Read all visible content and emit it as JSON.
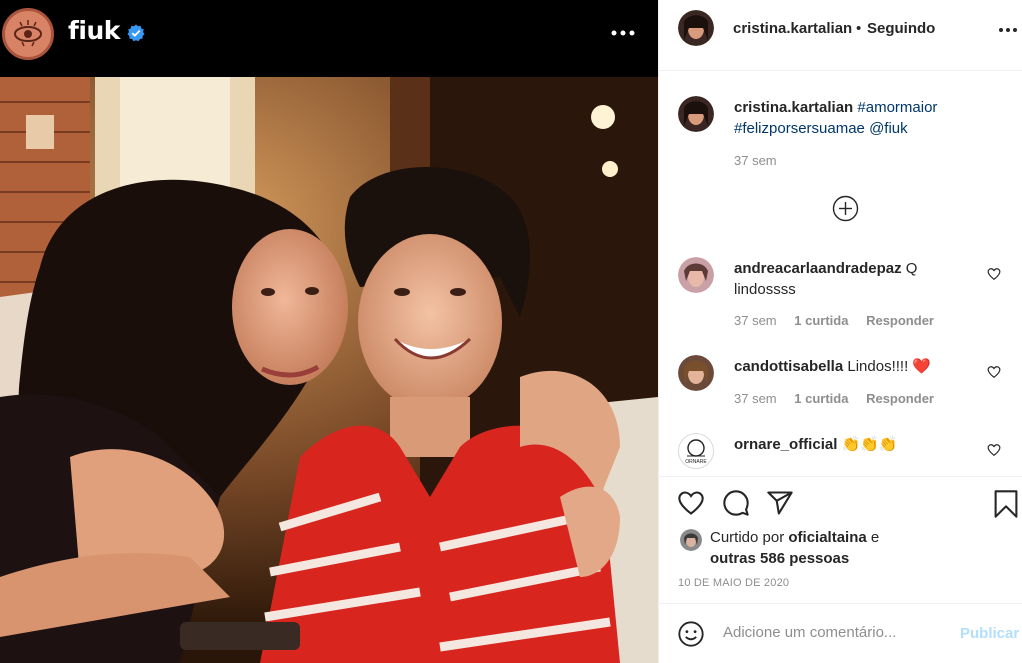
{
  "post_owner": {
    "username": "fiuk",
    "verified_icon": "verified-badge-icon"
  },
  "header": {
    "username": "cristina.kartalian",
    "separator": "•",
    "follow_status": "Seguindo"
  },
  "caption": {
    "username": "cristina.kartalian",
    "hashtag_1": "#amormaior",
    "hashtag_2": "#felizporsersuamae",
    "mention": "@fiuk",
    "time": "37 sem"
  },
  "comments": [
    {
      "username": "andreacarlaandradepaz",
      "text_line1": "Q",
      "text_line2": "lindossss",
      "time": "37 sem",
      "likes": "1 curtida",
      "reply": "Responder"
    },
    {
      "username": "candottisabella",
      "text": "Lindos!!!! ❤️",
      "time": "37 sem",
      "likes": "1 curtida",
      "reply": "Responder"
    },
    {
      "username": "ornare_official",
      "text": "👏👏👏",
      "avatar_text": "ORNARE"
    }
  ],
  "likes": {
    "prefix": "Curtido por",
    "user": "oficialtaina",
    "connector": "e",
    "others": "outras 586 pessoas"
  },
  "date": "10 DE MAIO DE 2020",
  "comment_box": {
    "placeholder": "Adicione um comentário...",
    "publish": "Publicar"
  },
  "colors": {
    "link": "#00376b",
    "publish_disabled": "#b2dffc",
    "meta": "#8e8e8e",
    "verified": "#3897f0",
    "text": "#262626"
  }
}
